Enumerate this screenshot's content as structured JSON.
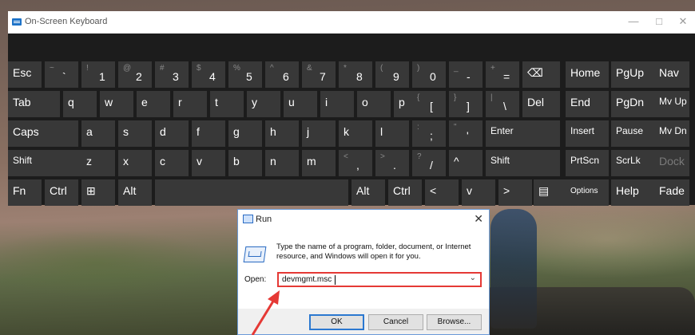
{
  "osk": {
    "title": "On-Screen Keyboard",
    "controls": {
      "minimize": "—",
      "maximize": "□",
      "close": "✕"
    },
    "rows": [
      [
        {
          "label": "Esc"
        },
        {
          "shift": "~",
          "label": "`",
          "dim": true
        },
        {
          "shift": "!",
          "label": "1"
        },
        {
          "shift": "@",
          "label": "2"
        },
        {
          "shift": "#",
          "label": "3"
        },
        {
          "shift": "$",
          "label": "4"
        },
        {
          "shift": "%",
          "label": "5"
        },
        {
          "shift": "^",
          "label": "6"
        },
        {
          "shift": "&",
          "label": "7"
        },
        {
          "shift": "*",
          "label": "8"
        },
        {
          "shift": "(",
          "label": "9"
        },
        {
          "shift": ")",
          "label": "0"
        },
        {
          "shift": "_",
          "label": "-",
          "dim": true
        },
        {
          "shift": "+",
          "label": "="
        },
        {
          "label": "⌫"
        },
        {
          "label": "Home"
        },
        {
          "label": "PgUp"
        },
        {
          "label": "Nav"
        }
      ],
      [
        {
          "label": "Tab"
        },
        {
          "label": "q"
        },
        {
          "label": "w"
        },
        {
          "label": "e"
        },
        {
          "label": "r"
        },
        {
          "label": "t"
        },
        {
          "label": "y"
        },
        {
          "label": "u"
        },
        {
          "label": "i"
        },
        {
          "label": "o"
        },
        {
          "label": "p"
        },
        {
          "shift": "{",
          "label": "["
        },
        {
          "shift": "}",
          "label": "]"
        },
        {
          "shift": "|",
          "label": "\\"
        },
        {
          "label": "Del"
        },
        {
          "label": "End"
        },
        {
          "label": "PgDn"
        },
        {
          "label": "Mv Up"
        }
      ],
      [
        {
          "label": "Caps"
        },
        {
          "label": "a"
        },
        {
          "label": "s"
        },
        {
          "label": "d"
        },
        {
          "label": "f"
        },
        {
          "label": "g"
        },
        {
          "label": "h"
        },
        {
          "label": "j"
        },
        {
          "label": "k"
        },
        {
          "label": "l"
        },
        {
          "shift": ":",
          "label": ";"
        },
        {
          "shift": "\"",
          "label": "'"
        },
        {
          "label": "Enter"
        },
        {
          "label": "Insert"
        },
        {
          "label": "Pause"
        },
        {
          "label": "Mv Dn"
        }
      ],
      [
        {
          "label": "Shift"
        },
        {
          "label": "z"
        },
        {
          "label": "x"
        },
        {
          "label": "c"
        },
        {
          "label": "v"
        },
        {
          "label": "b"
        },
        {
          "label": "n"
        },
        {
          "label": "m"
        },
        {
          "shift": "<",
          "label": ","
        },
        {
          "shift": ">",
          "label": "."
        },
        {
          "shift": "?",
          "label": "/"
        },
        {
          "label": "^"
        },
        {
          "label": "Shift"
        },
        {
          "label": "PrtScn"
        },
        {
          "label": "ScrLk"
        },
        {
          "label": "Dock",
          "dim": true
        }
      ],
      [
        {
          "label": "Fn"
        },
        {
          "label": "Ctrl"
        },
        {
          "label": "⊞"
        },
        {
          "label": "Alt"
        },
        {
          "label": ""
        },
        {
          "label": "Alt"
        },
        {
          "label": "Ctrl"
        },
        {
          "label": "<"
        },
        {
          "label": "v"
        },
        {
          "label": ">"
        },
        {
          "label": "▤"
        },
        {
          "label": "Options"
        },
        {
          "label": "Help"
        },
        {
          "label": "Fade"
        }
      ]
    ]
  },
  "run": {
    "title": "Run",
    "close": "✕",
    "description": "Type the name of a program, folder, document, or Internet resource, and Windows will open it for you.",
    "open_label": "Open:",
    "open_value": "devmgmt.msc",
    "dropdown": "⌄",
    "buttons": {
      "ok": "OK",
      "cancel": "Cancel",
      "browse": "Browse..."
    }
  },
  "colors": {
    "annotation": "#e53935",
    "key_bg": "#383838",
    "keyboard_bg": "#1c1c1c"
  }
}
